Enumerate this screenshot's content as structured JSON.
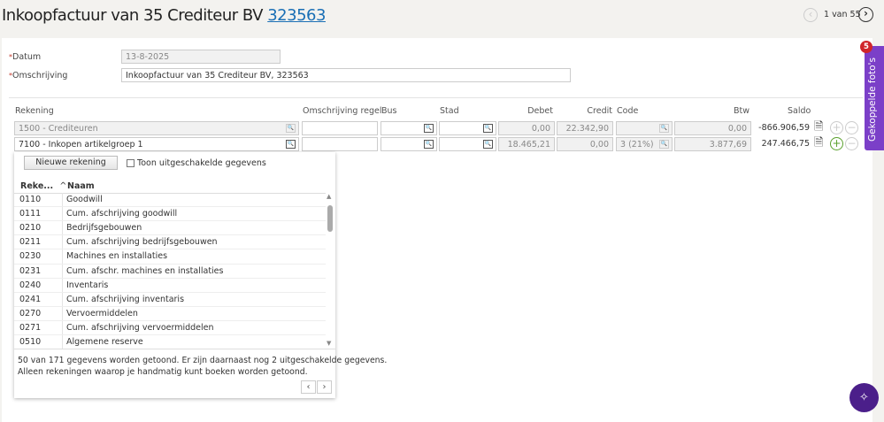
{
  "header": {
    "title": "Inkoopfactuur van 35 Crediteur BV",
    "title_link": "323563",
    "pager": "1 van 55"
  },
  "form": {
    "datum_label": "Datum",
    "datum_value": "13-8-2025",
    "omschrijving_label": "Omschrijving",
    "omschrijving_value": "Inkoopfactuur van 35 Crediteur BV, 323563"
  },
  "columns": {
    "rekening": "Rekening",
    "omschrijving_regel": "Omschrijving regel",
    "bus": "Bus",
    "stad": "Stad",
    "debet": "Debet",
    "credit": "Credit",
    "code": "Code",
    "btw": "Btw",
    "saldo": "Saldo"
  },
  "lines": [
    {
      "rekening": "1500 - Crediteuren",
      "debet": "0,00",
      "credit": "22.342,90",
      "code": "",
      "btw": "0,00",
      "saldo": "-866.906,59"
    },
    {
      "rekening": "7100 - Inkopen artikelgroep 1",
      "debet": "18.465,21",
      "credit": "0,00",
      "code": "3 (21%)",
      "btw": "3.877,69",
      "saldo": "247.466,75"
    }
  ],
  "dropdown": {
    "new_button": "Nieuwe rekening",
    "show_disabled": "Toon uitgeschakelde gegevens",
    "col_number": "Reke...",
    "col_name": "Naam",
    "rows": [
      {
        "nr": "0110",
        "naam": "Goodwill"
      },
      {
        "nr": "0111",
        "naam": "Cum. afschrijving goodwill"
      },
      {
        "nr": "0210",
        "naam": "Bedrijfsgebouwen"
      },
      {
        "nr": "0211",
        "naam": "Cum. afschrijving bedrijfsgebouwen"
      },
      {
        "nr": "0230",
        "naam": "Machines en installaties"
      },
      {
        "nr": "0231",
        "naam": "Cum. afschr. machines en installaties"
      },
      {
        "nr": "0240",
        "naam": "Inventaris"
      },
      {
        "nr": "0241",
        "naam": "Cum. afschrijving inventaris"
      },
      {
        "nr": "0270",
        "naam": "Vervoermiddelen"
      },
      {
        "nr": "0271",
        "naam": "Cum. afschrijving vervoermiddelen"
      },
      {
        "nr": "0510",
        "naam": "Algemene reserve"
      }
    ],
    "footer1": "50 van 171 gegevens worden getoond. Er zijn daarnaast nog 2 uitgeschakelde gegevens.",
    "footer2": "Alleen rekeningen waarop je handmatig kunt boeken worden getoond."
  },
  "side_tab": {
    "label": "Gekoppelde foto's",
    "badge": "5"
  },
  "colors": {
    "accent": "#7b3fc8",
    "fab": "#4b1f8a",
    "badge": "#d0262b",
    "add": "#5aa02c",
    "link": "#1a6fb5"
  },
  "icons": [
    "chevron-left-icon",
    "chevron-right-icon",
    "lookup-icon",
    "document-link-icon",
    "plus-circle-icon",
    "minus-circle-icon",
    "sort-up-icon",
    "sparkle-icon"
  ]
}
